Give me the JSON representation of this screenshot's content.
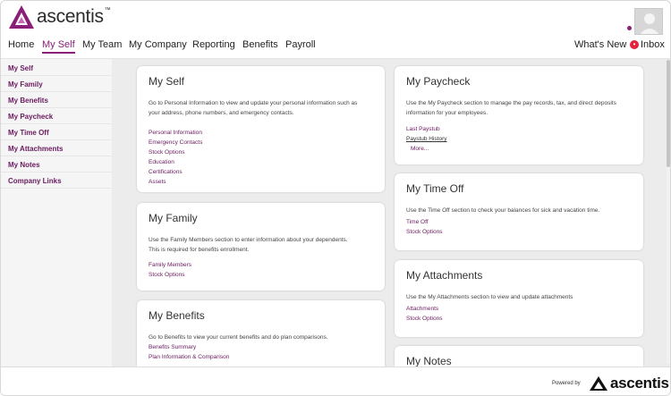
{
  "brand": {
    "name": "ascentis",
    "tm": "™",
    "color": "#8a1f78"
  },
  "nav": {
    "items": [
      "Home",
      "My Self",
      "My Team",
      "My Company",
      "Reporting",
      "Benefits",
      "Payroll"
    ],
    "active": "My Self",
    "whats_new": "What's New",
    "inbox": "Inbox"
  },
  "sidebar": {
    "items": [
      "My Self",
      "My Family",
      "My Benefits",
      "My Paycheck",
      "My Time Off",
      "My Attachments",
      "My Notes",
      "Company Links"
    ]
  },
  "cards": {
    "my_self": {
      "title": "My Self",
      "desc1": "Go to Personal Information to view and update your personal information such as",
      "desc2": "your address, phone numbers, and emergency contacts.",
      "links": [
        "Personal Information",
        "Emergency Contacts",
        "Stock Options",
        "Education",
        "Certifications",
        "Assets"
      ]
    },
    "my_family": {
      "title": "My Family",
      "desc1": "Use the Family Members section to enter information about your dependents.",
      "desc2": "This is required for benefits enrollment.",
      "links": [
        "Family Members",
        "Stock Options"
      ]
    },
    "my_benefits": {
      "title": "My Benefits",
      "desc1": "Go to Benefits to view your current benefits and do plan comparisons.",
      "links": [
        "Benefits Summary",
        "Plan Information & Comparison"
      ]
    },
    "my_paycheck": {
      "title": "My Paycheck",
      "desc1": "Use the My Paycheck section to manage the pay records, tax, and direct deposits",
      "desc2": "information for your employees.",
      "links": [
        "Last Paystub",
        "Paystub History",
        "More..."
      ]
    },
    "my_time_off": {
      "title": "My Time Off",
      "desc1": "Use the Time Off section to check your balances for sick and vacation time.",
      "links": [
        "Time Off",
        "Stock Options"
      ]
    },
    "my_attachments": {
      "title": "My Attachments",
      "desc1": "Use the My Attachments section to view and update attachments",
      "links": [
        "Attachments",
        "Stock Options"
      ]
    },
    "my_notes": {
      "title": "My Notes"
    }
  },
  "footer": {
    "powered_by": "Powered by",
    "brand": "ascentis"
  }
}
